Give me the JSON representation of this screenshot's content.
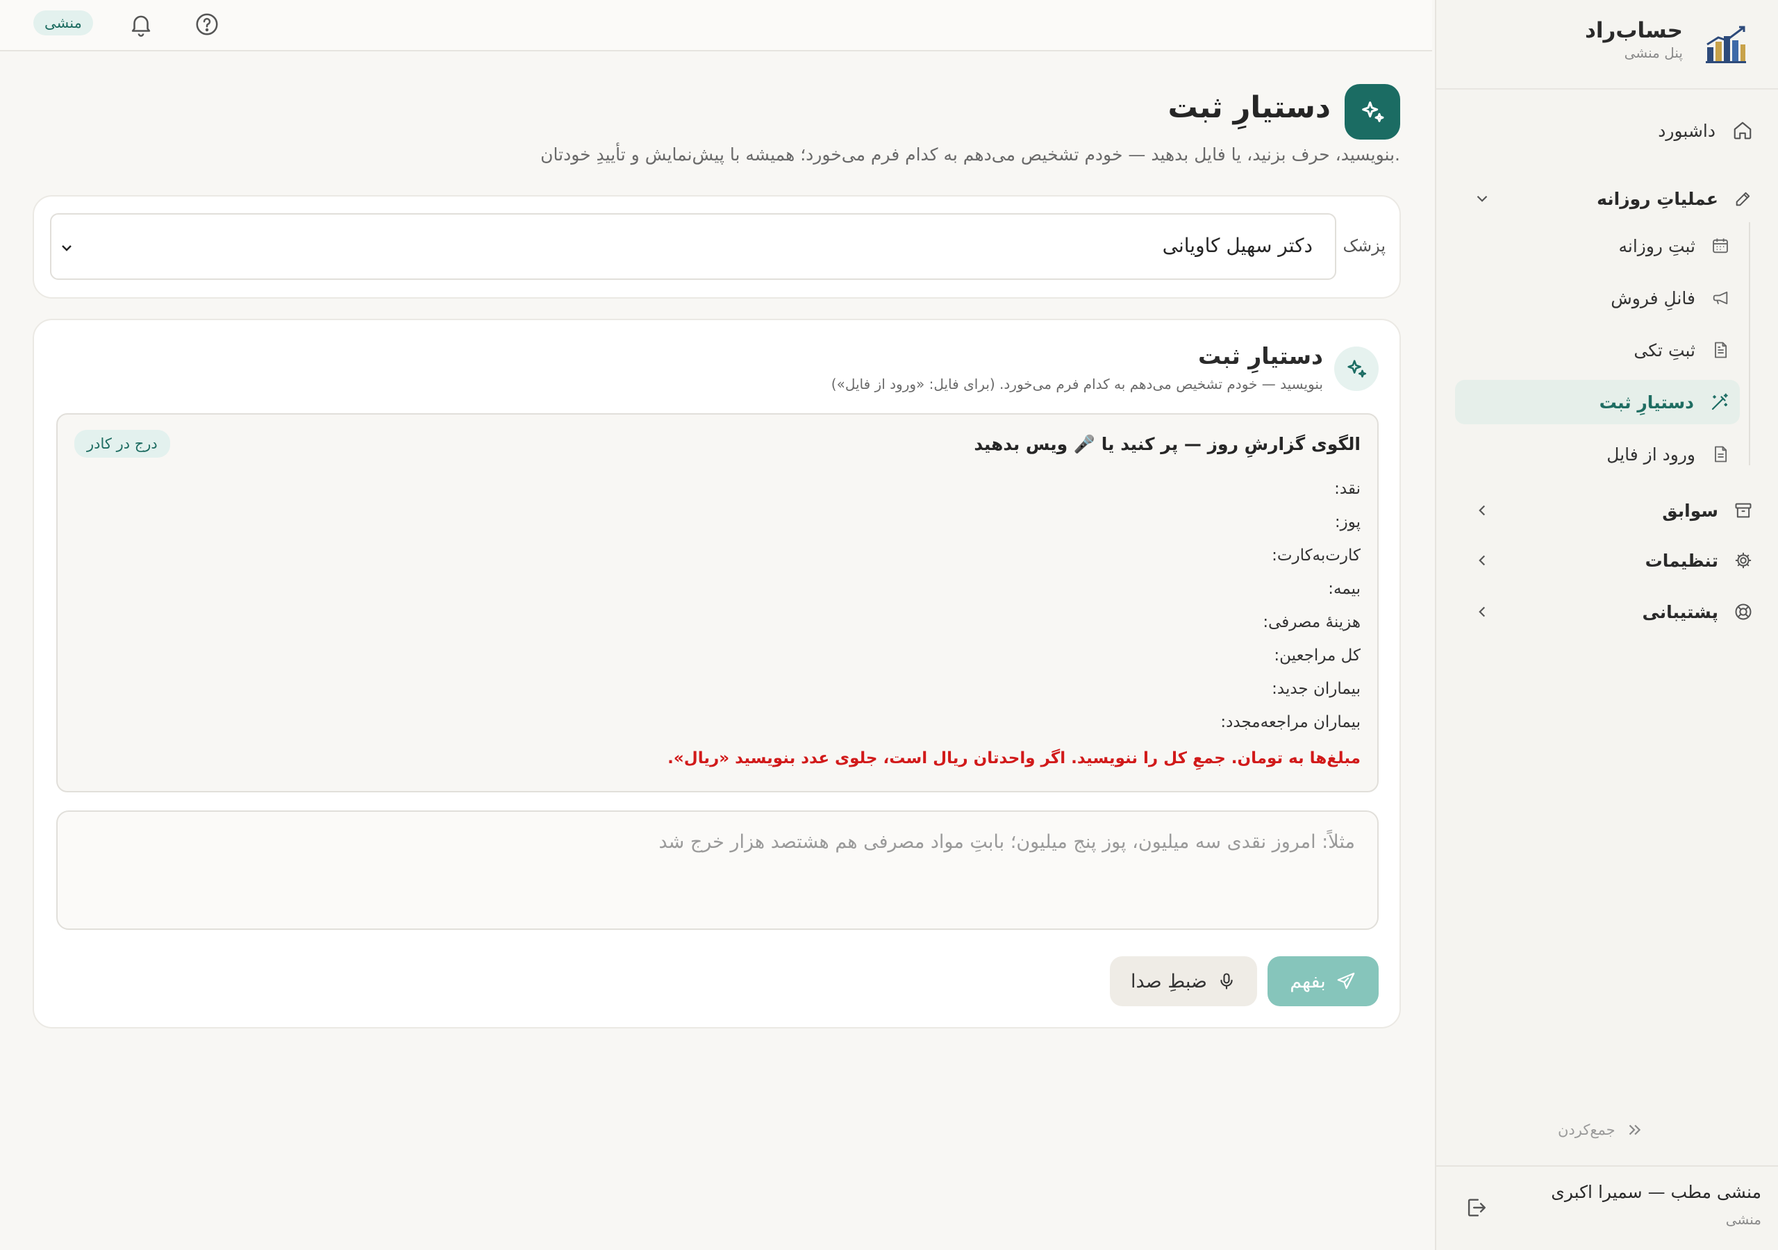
{
  "brand": {
    "name": "حساب‌راد",
    "subtitle": "پنل منشی"
  },
  "topbar": {
    "role_chip": "منشی"
  },
  "nav": {
    "dashboard": "داشبورد",
    "daily_ops": "عملیاتِ روزانه",
    "daily_ops_items": [
      {
        "label": "ثبتِ روزانه",
        "icon": "calendar-icon"
      },
      {
        "label": "فانلِ فروش",
        "icon": "megaphone-icon"
      },
      {
        "label": "ثبتِ تکی",
        "icon": "document-icon"
      },
      {
        "label": "دستیارِ ثبت",
        "icon": "magic-wand-icon",
        "active": true
      },
      {
        "label": "ورود از فایل",
        "icon": "file-icon"
      }
    ],
    "history": "سوابق",
    "settings": "تنظیمات",
    "support": "پشتیبانی",
    "collapse": "جمع‌کردن"
  },
  "user": {
    "name": "منشی مطب — سمیرا اکبری",
    "role": "منشی"
  },
  "page": {
    "title": "دستیارِ ثبت",
    "subtitle": "بنویسید، حرف بزنید، یا فایل بدهید — خودم تشخیص می‌دهم به کدام فرم می‌خورد؛ همیشه با پیش‌نمایش و تأییدِ خودتان."
  },
  "physician": {
    "label": "پزشک",
    "value": "دکتر سهیل کاویانی"
  },
  "assistant": {
    "title": "دستیارِ ثبت",
    "subtitle": "بنویسید — خودم تشخیص می‌دهم به کدام فرم می‌خورد. (برای فایل: «ورود از فایل»)",
    "template": {
      "heading": "الگوی گزارشِ روز — پر کنید یا 🎤 ویس بدهید",
      "insert_label": "درج در کادر",
      "lines": [
        "نقد:",
        "پوز:",
        "کارت‌به‌کارت:",
        "بیمه:",
        "هزینهٔ مصرفی:",
        "کل مراجعین:",
        "بیماران جدید:",
        "بیماران مراجعه‌مجدد:"
      ],
      "note": "مبلغ‌ها به تومان. جمعِ کل را ننویسید. اگر واحدتان ریال است، جلوی عدد بنویسید «ریال»."
    },
    "input_placeholder": "مثلاً: امروز نقدی سه میلیون، پوز پنج میلیون؛ بابتِ مواد مصرفی هم هشتصد هزار خرج شد",
    "send_label": "بفهم",
    "record_label": "ضبطِ صدا"
  },
  "colors": {
    "accent": "#1b6c63",
    "accent_light": "#e3f1ee",
    "warning_text": "#d11a1a",
    "send_button": "#86c5bb"
  }
}
